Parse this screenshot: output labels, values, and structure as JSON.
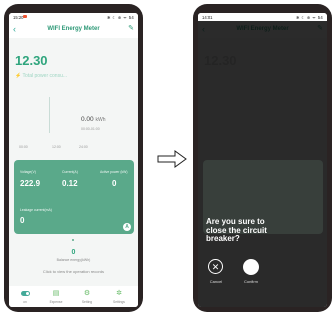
{
  "status_bar_left": {
    "time": "15:20",
    "icons": "✻ ☾ ⊕ ᯤ 54"
  },
  "status_bar_right": {
    "time": "14:01",
    "icons": "✻ ☾ ⊕ ᯤ 54"
  },
  "app": {
    "title": "WIFI Energy Meter",
    "back": "‹",
    "edit": "✎"
  },
  "left": {
    "time_value": "12.30",
    "total_label": "Total power consu...",
    "kwh_value": "0.00",
    "kwh_unit": "kWh",
    "kwh_sub": "00:00-01:00",
    "x_labels": [
      "00:00",
      "12:00",
      "24:00"
    ],
    "readings": [
      {
        "label": "Voltage(V)",
        "value": "222.9"
      },
      {
        "label": "Current(A)",
        "value": "0.12"
      },
      {
        "label": "Active power (kW)",
        "value": "0"
      },
      {
        "label": "Leakage current(mA)",
        "value": "0"
      }
    ],
    "badge": "A",
    "balance_value": "0",
    "balance_label": "Balance energy(kWh)",
    "operation_info": "Click to view the operation records",
    "nav": [
      "on",
      "Expense",
      "Setting",
      "Settings"
    ]
  },
  "right": {
    "prompt": "Are you sure to close the circuit breaker?",
    "cancel_label": "Cancel",
    "confirm_label": "Confirm"
  },
  "colors": {
    "accent": "#2fa57d",
    "card": "#5aa98a",
    "phone_frame": "#2a2323"
  }
}
